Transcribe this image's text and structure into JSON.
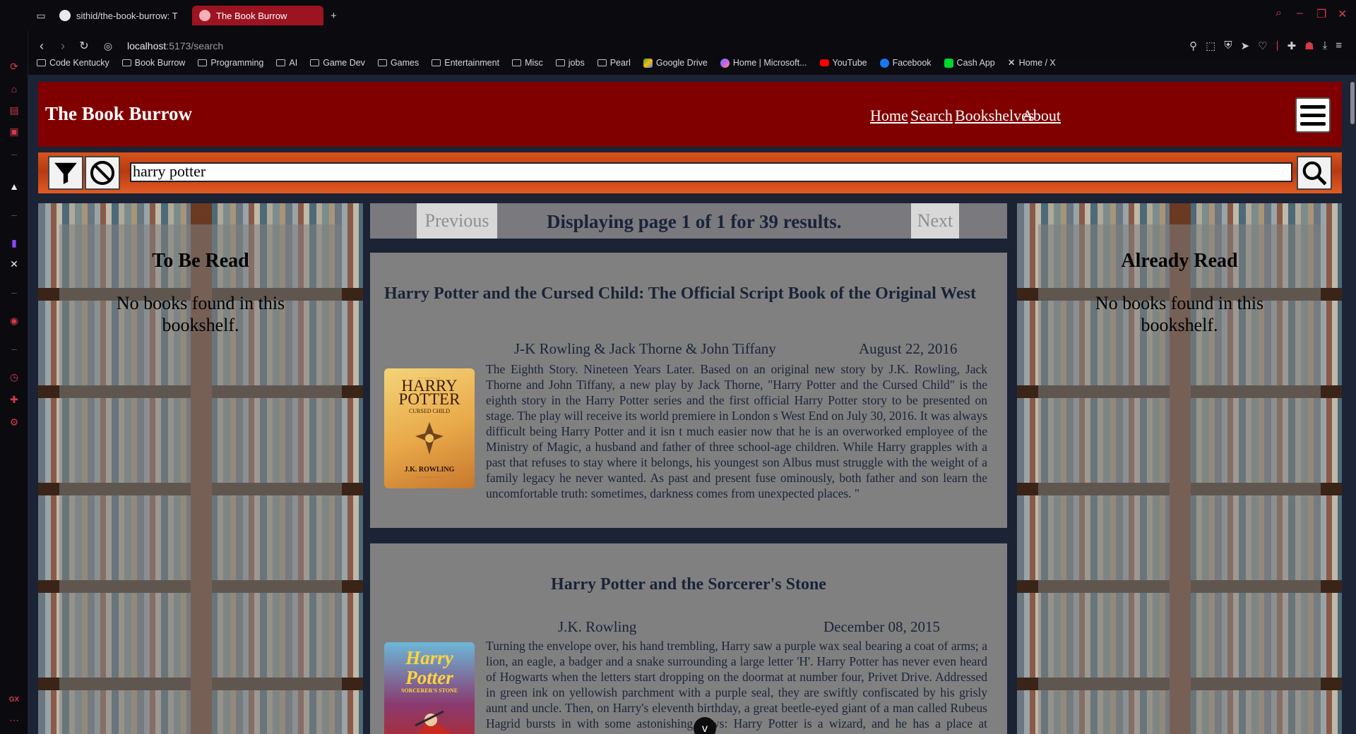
{
  "browser": {
    "tabs": [
      {
        "title": "sithid/the-book-burrow: T"
      },
      {
        "title": "The Book Burrow"
      }
    ],
    "new_tab_label": "+",
    "url_host": "localhost",
    "url_path": ":5173/search",
    "bookmarks": [
      {
        "label": "Code Kentucky",
        "icon": "folder-icon"
      },
      {
        "label": "Book Burrow",
        "icon": "folder-icon"
      },
      {
        "label": "Programming",
        "icon": "folder-icon"
      },
      {
        "label": "AI",
        "icon": "folder-icon"
      },
      {
        "label": "Game Dev",
        "icon": "folder-icon"
      },
      {
        "label": "Games",
        "icon": "folder-icon"
      },
      {
        "label": "Entertainment",
        "icon": "folder-icon"
      },
      {
        "label": "Misc",
        "icon": "folder-icon"
      },
      {
        "label": "jobs",
        "icon": "folder-icon"
      },
      {
        "label": "Pearl",
        "icon": "folder-icon"
      },
      {
        "label": "Google Drive",
        "icon": "google-drive-icon"
      },
      {
        "label": "Home | Microsoft...",
        "icon": "microsoft-icon"
      },
      {
        "label": "YouTube",
        "icon": "youtube-icon"
      },
      {
        "label": "Facebook",
        "icon": "facebook-icon"
      },
      {
        "label": "Cash App",
        "icon": "cash-app-icon"
      },
      {
        "label": "Home / X",
        "icon": "x-icon"
      }
    ],
    "sidebar_badge": "GX"
  },
  "site": {
    "brand": "The Book Burrow",
    "nav": {
      "home": "Home",
      "search": "Search",
      "bookshelves": "Bookshelves",
      "about": "About"
    },
    "accent_color": "#800000"
  },
  "search": {
    "query": "harry potter"
  },
  "shelves": {
    "to_be_read": {
      "title": "To Be Read",
      "empty_text": "No books found in this bookshelf."
    },
    "already_read": {
      "title": "Already Read",
      "empty_text": "No books found in this bookshelf."
    }
  },
  "pager": {
    "previous": "Previous",
    "next": "Next",
    "status": "Displaying page 1 of 1 for 39 results."
  },
  "results": [
    {
      "title": "Harry Potter and the Cursed Child: The Official Script Book of the Original West",
      "authors": "J-K Rowling & Jack Thorne & John Tiffany",
      "date": "August 22, 2016",
      "description": "The Eighth Story. Nineteen Years Later. Based on an original new story by J.K. Rowling, Jack Thorne and John Tiffany, a new play by Jack Thorne, \"Harry Potter and the Cursed Child\" is the eighth story in the Harry Potter series and the first official Harry Potter story to be presented on stage. The play will receive its world premiere in London s West End on July 30, 2016. It was always difficult being Harry Potter and it isn t much easier now that he is an overworked employee of the Ministry of Magic, a husband and father of three school-age children. While Harry grapples with a past that refuses to stay where it belongs, his youngest son Albus must struggle with the weight of a family legacy he never wanted. As past and present fuse ominously, both father and son learn the uncomfortable truth: sometimes, darkness comes from unexpected places. \"",
      "cover": {
        "line1": "HARRY",
        "line2": "POTTER",
        "subtitle": "CURSED CHILD",
        "author": "J.K. ROWLING"
      }
    },
    {
      "title": "Harry Potter and the Sorcerer's Stone",
      "authors": "J.K. Rowling",
      "date": "December 08, 2015",
      "description": "Turning the envelope over, his hand trembling, Harry saw a purple wax seal bearing a coat of arms; a lion, an eagle, a badger and a snake surrounding a large letter 'H'. Harry Potter has never even heard of Hogwarts when the letters start dropping on the doormat at number four, Privet Drive. Addressed in green ink on yellowish parchment with a purple seal, they are swiftly confiscated by his grisly aunt and uncle. Then, on Harry's eleventh birthday, a great beetle-eyed giant of a man called Rubeus Hagrid bursts in with some astonishing news: Harry Potter is a wizard, and he has a place at Hogwarts School of",
      "cover": {
        "line1": "Harry Potter",
        "subtitle": "SORCERER'S STONE"
      }
    }
  ],
  "scroll_down_label": "v"
}
